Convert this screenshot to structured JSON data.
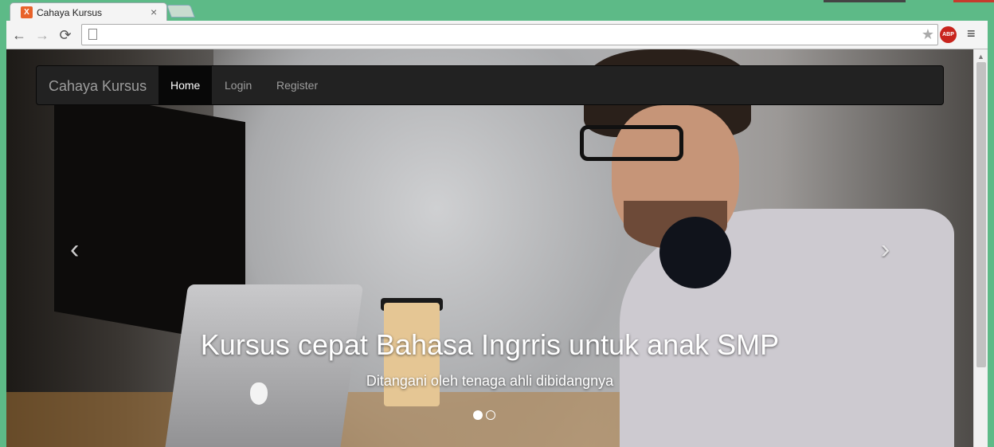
{
  "browser": {
    "tab_title": "Cahaya Kursus",
    "tab_close": "×",
    "favicon_label": "X",
    "address_value": "",
    "abp_label": "ABP",
    "icons": {
      "back": "back-arrow-icon",
      "forward": "forward-arrow-icon",
      "reload": "reload-icon",
      "bookmark": "star-icon",
      "menu": "hamburger-menu-icon"
    },
    "glyphs": {
      "back": "←",
      "forward": "→",
      "reload": "⟳",
      "star": "★",
      "menu": "≡",
      "scroll_up": "▲"
    }
  },
  "navbar": {
    "brand": "Cahaya Kursus",
    "items": [
      {
        "label": "Home",
        "active": true
      },
      {
        "label": "Login",
        "active": false
      },
      {
        "label": "Register",
        "active": false
      }
    ]
  },
  "carousel": {
    "prev_glyph": "‹",
    "next_glyph": "›",
    "caption_title": "Kursus cepat Bahasa Ingrris untuk anak SMP",
    "caption_subtitle": "Ditangani oleh tenaga ahli dibidangnya",
    "indicator_count": 2,
    "active_index": 0
  },
  "colors": {
    "frame": "#5dba87",
    "navbar_bg": "#222222",
    "navbar_active": "#080808",
    "navbar_text": "#9d9d9d"
  }
}
